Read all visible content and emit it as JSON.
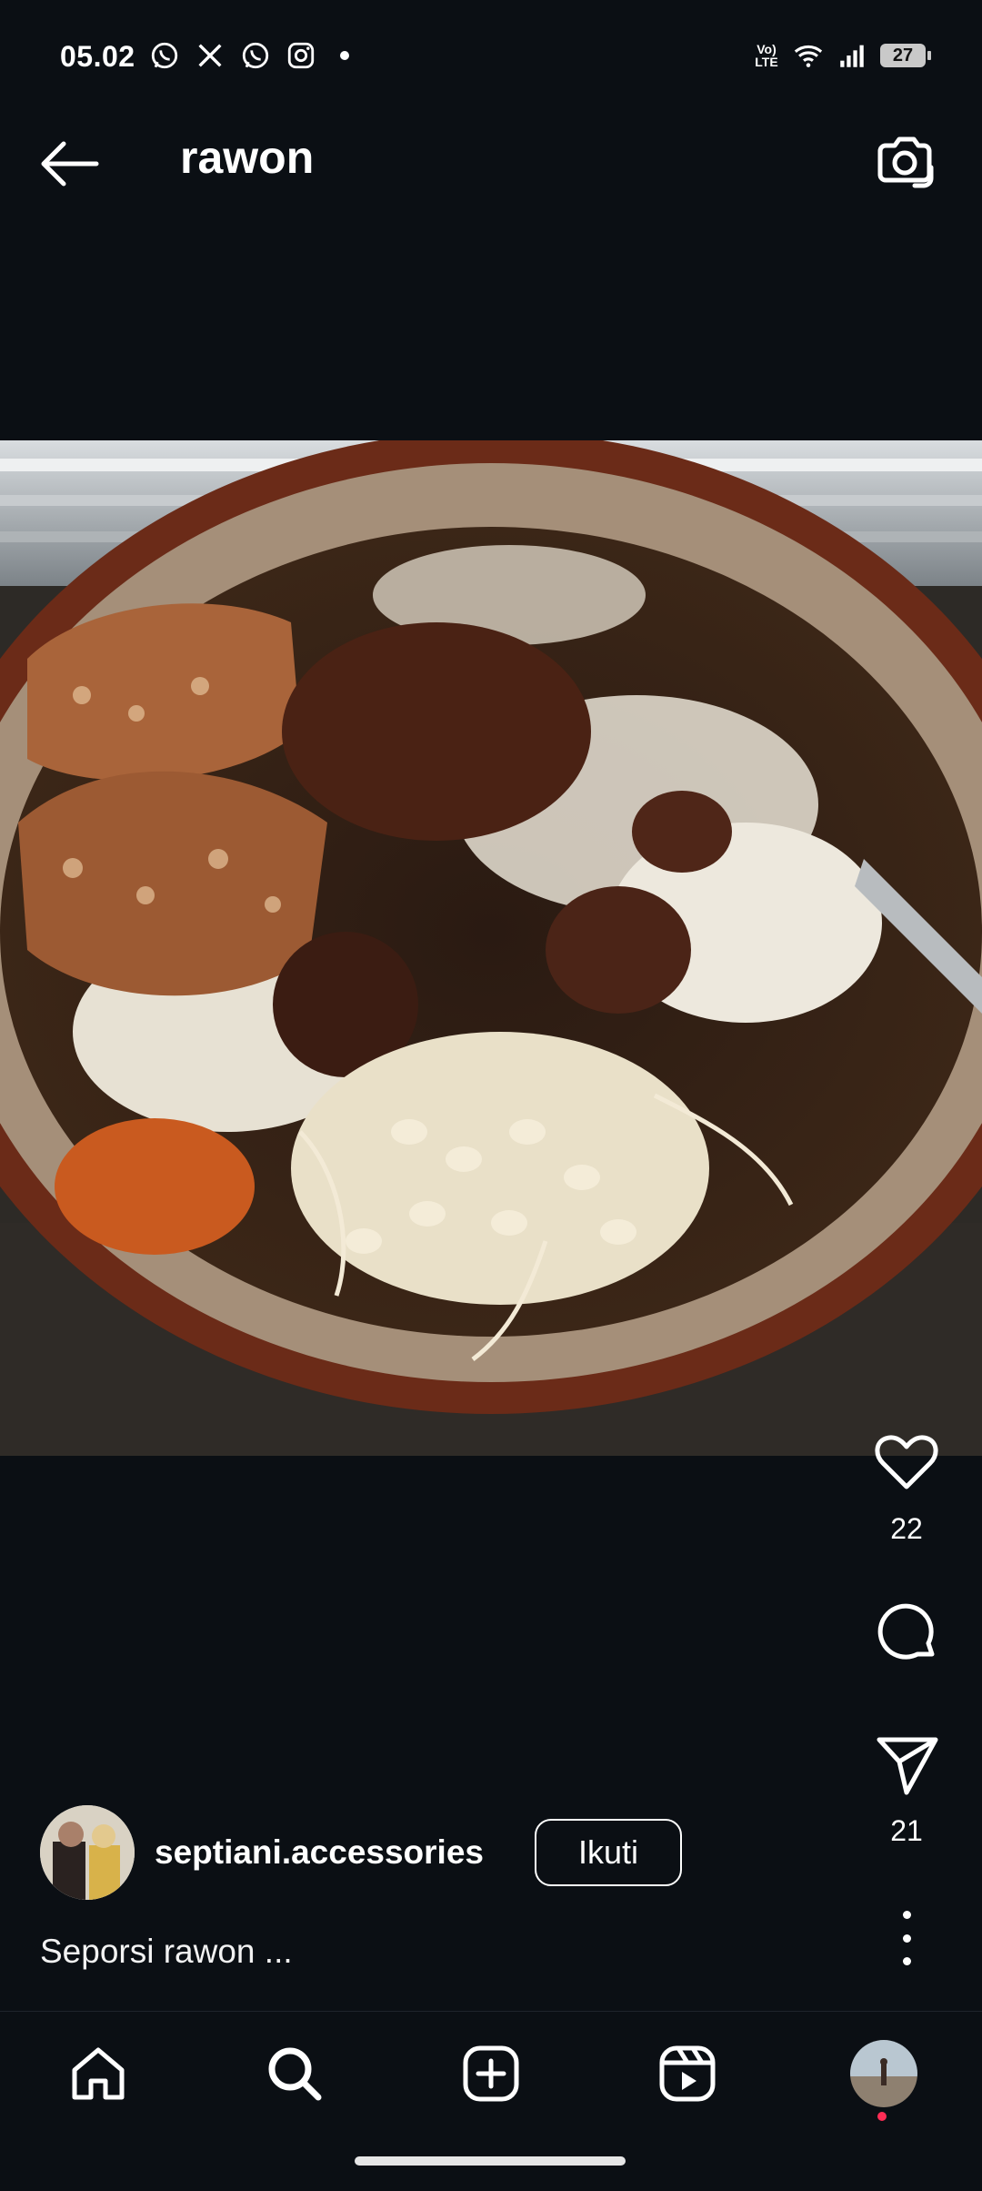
{
  "status_bar": {
    "time": "05.02",
    "notification_icons": [
      "whatsapp-icon",
      "x-icon",
      "whatsapp-icon",
      "instagram-icon"
    ],
    "network_label": "Vo) LTE",
    "battery": "27"
  },
  "header": {
    "title": "rawon"
  },
  "post": {
    "image_subject": "rawon-dish-photo",
    "like_count": "22",
    "share_count": "21",
    "author": {
      "username": "septiani.accessories",
      "follow_label": "Ikuti"
    },
    "caption": "Seporsi rawon ..."
  },
  "colors": {
    "background": "#0b0f14",
    "text": "#ffffff",
    "notification_dot": "#ff2d55"
  }
}
